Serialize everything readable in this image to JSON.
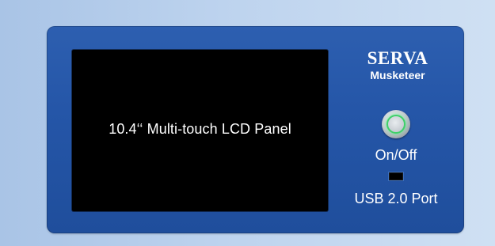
{
  "screen": {
    "label": "10.4‘‘ Multi-touch LCD Panel"
  },
  "brand": {
    "name": "SERVA",
    "model": "Musketeer"
  },
  "power": {
    "label": "On/Off",
    "icon": "power-button-icon",
    "indicator_color": "#3fd06a"
  },
  "usb": {
    "label": "USB 2.0 Port",
    "icon": "usb-port-icon"
  },
  "colors": {
    "panel": "#2556a8",
    "background": "#bdd3ee",
    "screen": "#000000"
  }
}
